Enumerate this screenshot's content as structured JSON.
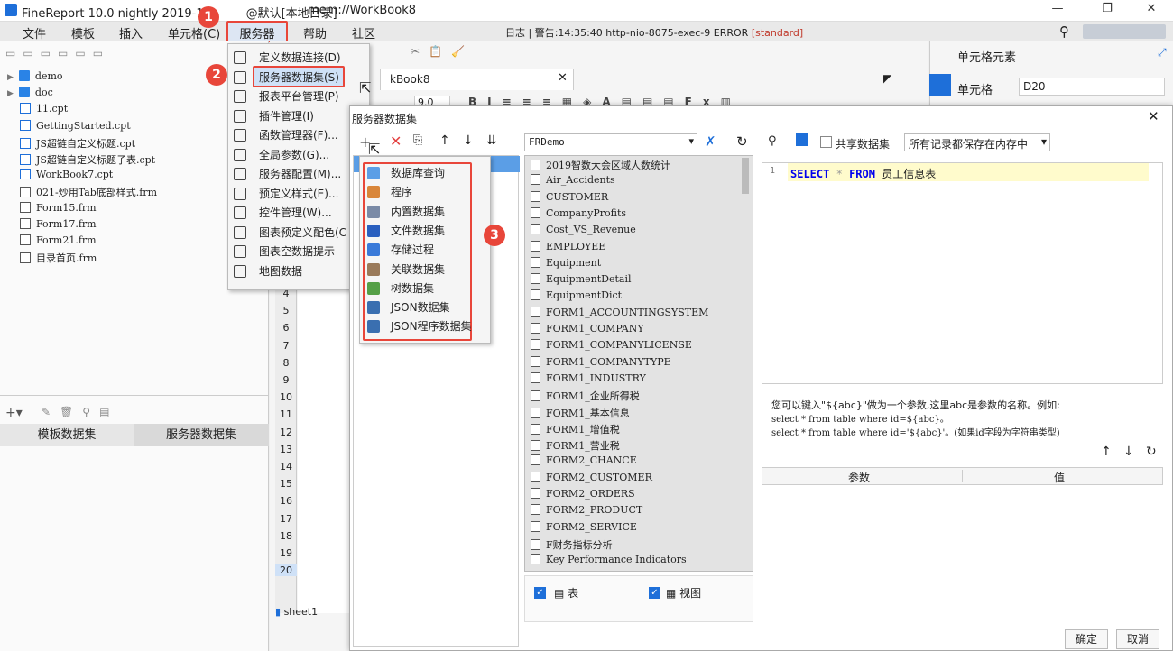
{
  "window": {
    "title": "FineReport 10.0 nightly 2019-11-",
    "title_suffix": "@默认[本地目录]",
    "workbook": "mem://WorkBook8",
    "controls": [
      "—",
      "❐",
      "✕"
    ]
  },
  "menubar": {
    "items": [
      "文件",
      "模板",
      "插入",
      "单元格(C)",
      "服务器",
      "帮助",
      "社区"
    ],
    "log_text": "日志 | 警告:14:35:40 http-nio-8075-exec-9 ERROR ",
    "log_tag": "[standard]"
  },
  "tree": {
    "items": [
      {
        "name": "demo",
        "type": "folder"
      },
      {
        "name": "doc",
        "type": "folder"
      },
      {
        "name": "11.cpt",
        "type": "cpt"
      },
      {
        "name": "GettingStarted.cpt",
        "type": "cpt"
      },
      {
        "name": "JS超链自定义标题.cpt",
        "type": "cpt"
      },
      {
        "name": "JS超链自定义标题子表.cpt",
        "type": "cpt"
      },
      {
        "name": "WorkBook7.cpt",
        "type": "cpt"
      },
      {
        "name": "021-炒用Tab底部样式.frm",
        "type": "frm"
      },
      {
        "name": "Form15.frm",
        "type": "frm"
      },
      {
        "name": "Form17.frm",
        "type": "frm"
      },
      {
        "name": "Form21.frm",
        "type": "frm"
      },
      {
        "name": "目录首页.frm",
        "type": "frm"
      }
    ]
  },
  "datasetTabs": {
    "template": "模板数据集",
    "server": "服务器数据集"
  },
  "serverMenu": {
    "items": [
      "定义数据连接(D)",
      "服务器数据集(S)",
      "报表平台管理(P)",
      "插件管理(I)",
      "函数管理器(F)...",
      "全局参数(G)...",
      "服务器配置(M)...",
      "预定义样式(E)...",
      "控件管理(W)...",
      "图表预定义配色(C",
      "图表空数据提示",
      "地图数据"
    ]
  },
  "editor": {
    "tab": "kBook8",
    "font_size": "9.0",
    "rows": [
      "4",
      "5",
      "6",
      "7",
      "8",
      "9",
      "10",
      "11",
      "12",
      "13",
      "14",
      "15",
      "16",
      "17",
      "18",
      "19",
      "20"
    ],
    "sheet": "sheet1"
  },
  "rightPanel": {
    "title": "单元格元素",
    "cell_label": "单元格",
    "cell_value": "D20"
  },
  "dialog": {
    "title": "服务器数据集",
    "addMenu": [
      "数据库查询",
      "程序",
      "内置数据集",
      "文件数据集",
      "存储过程",
      "关联数据集",
      "树数据集",
      "JSON数据集",
      "JSON程序数据集"
    ],
    "connection": "FRDemo",
    "tables": [
      "2019智数大会区域人数统计",
      "Air_Accidents",
      "CUSTOMER",
      "CompanyProfits",
      "Cost_VS_Revenue",
      "EMPLOYEE",
      "Equipment",
      "EquipmentDetail",
      "EquipmentDict",
      "FORM1_ACCOUNTINGSYSTEM",
      "FORM1_COMPANY",
      "FORM1_COMPANYLICENSE",
      "FORM1_COMPANYTYPE",
      "FORM1_INDUSTRY",
      "FORM1_企业所得税",
      "FORM1_基本信息",
      "FORM1_增值税",
      "FORM1_营业税",
      "FORM2_CHANCE",
      "FORM2_CUSTOMER",
      "FORM2_ORDERS",
      "FORM2_PRODUCT",
      "FORM2_SERVICE",
      "F财务指标分析",
      "Key Performance Indicators"
    ],
    "filter_table": "表",
    "filter_view": "视图",
    "share_label": "共享数据集",
    "memory_option": "所有记录都保存在内存中",
    "sql_line_no": "1",
    "sql_kw1": "SELECT",
    "sql_star": "*",
    "sql_kw2": "FROM",
    "sql_table": "员工信息表",
    "hint1": "您可以键入\"${abc}\"做为一个参数,这里abc是参数的名称。例如:",
    "hint2": "select * from table where id=${abc}。",
    "hint3": "select * from table where id='${abc}'。(如果id字段为字符串类型)",
    "param_col": "参数",
    "value_col": "值",
    "ok": "确定",
    "cancel": "取消"
  },
  "badges": [
    "1",
    "2",
    "3"
  ],
  "colors": {
    "accent": "#1e6fd9",
    "highlight": "#e8463a",
    "sql_bg": "#fffbcc"
  }
}
